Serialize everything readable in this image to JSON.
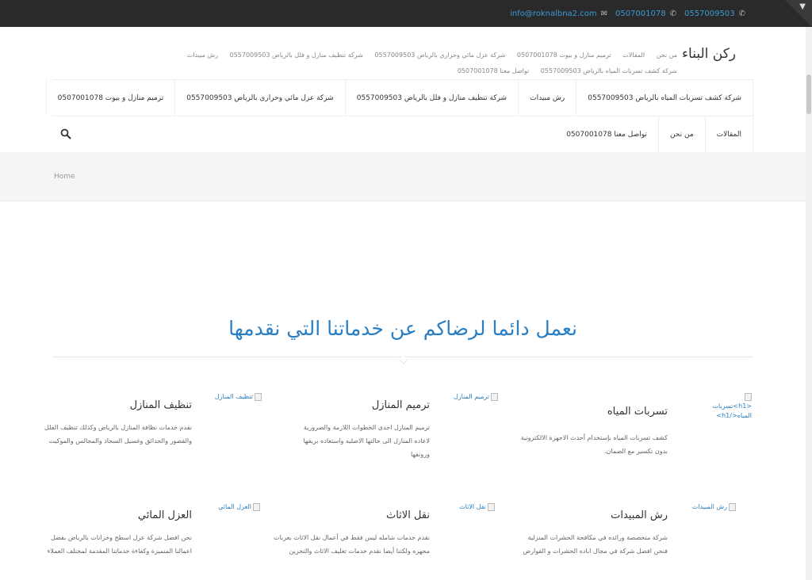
{
  "topbar": {
    "phone1": "0557009503",
    "phone2": "0507001078",
    "email": "info@roknalbna2.com"
  },
  "logo": "ركن البناء",
  "mini_menu": [
    "من نحن",
    "المقالات",
    "ترميم منازل و بيوت 0507001078",
    "شركة عزل مائي وحراري بالرياض 0557009503",
    "شركة تنظيف منازل و فلل بالرياض 0557009503",
    "رش مبيدات",
    "شركة كشف تسربات المياه بالرياض 0557009503",
    "تواصل معنا 0507001078"
  ],
  "nav": {
    "row1": [
      "شركة كشف تسربات المياه بالرياض 0557009503",
      "رش مبيدات",
      "شركة تنظيف منازل و فلل بالرياض 0557009503",
      "شركة عزل مائي وحراري بالرياض 0557009503",
      "ترميم منازل و بيوت 0507001078"
    ],
    "row2": [
      "المقالات",
      "من نحن",
      "تواصل معنا 0507001078"
    ]
  },
  "breadcrumb": "Home",
  "section_title": "نعمل دائما لرضاكم عن خدماتنا التي نقدمها",
  "services": [
    {
      "icon_alt_line1": "<h1>تسربات",
      "icon_alt_line2": "المياه</h1>",
      "title": "تسربات المياه",
      "desc_line1": "كشف تسربات المياه بإستخدام أحدث الاجهزة الالكترونية",
      "desc_line2": "بدون تكسير مع الضمان.",
      "desc_line3": ""
    },
    {
      "icon_alt_line1": "ترميم المنازل",
      "icon_alt_line2": "",
      "title": "ترميم المنازل",
      "desc_line1": "ترميم المنازل احدى الخطوات اللازمة والضرورية",
      "desc_line2": "لاعاده المنازل الى حالتها الاصليه واستعاده بريقها",
      "desc_line3": "ورونقها"
    },
    {
      "icon_alt_line1": "تنظيف المنازل",
      "icon_alt_line2": "",
      "title": "تنظيف المنازل",
      "desc_line1": "نقدم خدمات نظافة المنازل بالرياض وكذلك تنظيف الفلل",
      "desc_line2": "والقصور والحدائق وغسيل السجاد والمجالس والموكيت",
      "desc_line3": ""
    },
    {
      "icon_alt_line1": "رش المبيدات",
      "icon_alt_line2": "",
      "title": "رش المبيدات",
      "desc_line1": "شركة متخصصة ورائده في مكافحة الحشرات المنزلية",
      "desc_line2": "فنحن افضل شركة في مجال اباده الحشرات و القوارض",
      "desc_line3": ""
    },
    {
      "icon_alt_line1": "نقل الاثاث",
      "icon_alt_line2": "",
      "title": "نقل الاثاث",
      "desc_line1": "نقدم خدمات شامله ليس فقط في أعمال نقل الاثاث بعربات",
      "desc_line2": "مجهزه ولكننا أيضا نقدم خدمات تغليف الاثاث والتخزين",
      "desc_line3": ""
    },
    {
      "icon_alt_line1": "العزل المائي",
      "icon_alt_line2": "",
      "title": "العزل المائي",
      "desc_line1": "نحن افضل شركة عزل اسطح وخزانات بالرياض بفضل",
      "desc_line2": "اعمالنا المتميزة وكفاءة خدماتنا المقدمة لمختلف العملاء",
      "desc_line3": ""
    }
  ],
  "colors": {
    "accent": "#2a7fc4",
    "topbar_bg": "#2a2a2a",
    "band_bg": "#f5f5f5"
  }
}
